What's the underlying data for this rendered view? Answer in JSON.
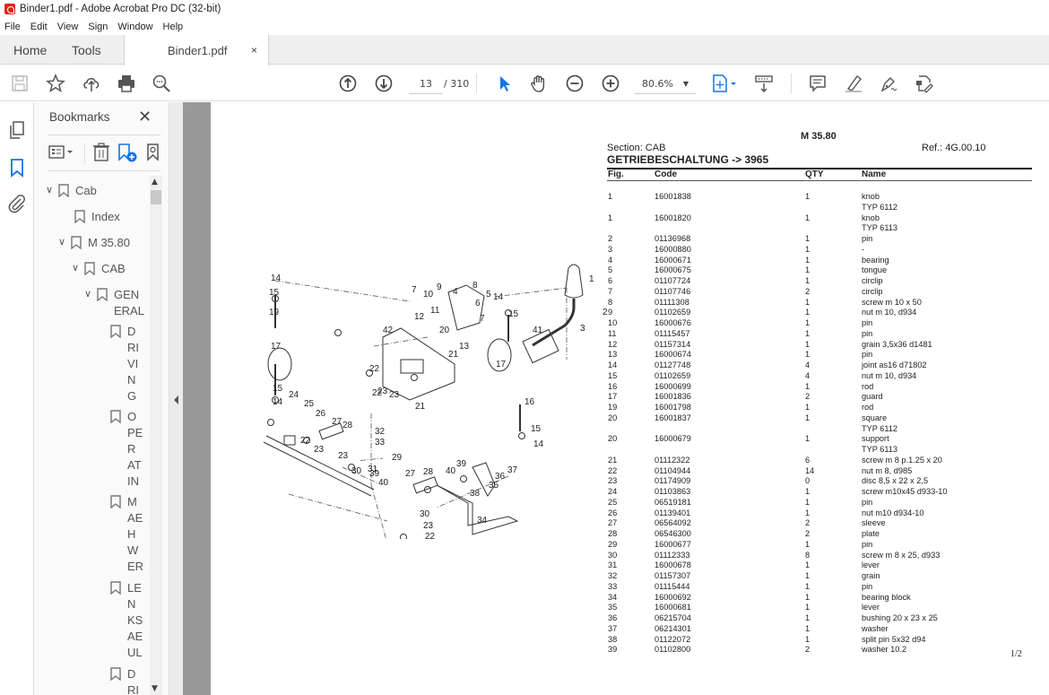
{
  "window": {
    "title": "Binder1.pdf - Adobe Acrobat Pro DC (32-bit)"
  },
  "menu": [
    "File",
    "Edit",
    "View",
    "Sign",
    "Window",
    "Help"
  ],
  "tabs": {
    "home": "Home",
    "tools": "Tools",
    "document": "Binder1.pdf",
    "close": "×"
  },
  "toolbar": {
    "current_page": "13",
    "total_pages": "/ 310",
    "zoom": "80.6%",
    "icons": [
      "save-icon",
      "bookmark-star-icon",
      "upload-cloud-icon",
      "print-icon",
      "search-zoom-icon",
      "page-up-icon",
      "page-down-icon",
      "select-cursor-icon",
      "hand-pan-icon",
      "zoom-out-icon",
      "zoom-in-icon",
      "fit-page-icon",
      "scroll-mode-icon",
      "comment-icon",
      "highlight-icon",
      "sign-icon",
      "fill-sign-icon"
    ],
    "accent": "#1473e6"
  },
  "panel": {
    "title": "Bookmarks",
    "close": "✕",
    "tree": [
      {
        "label": "Cab",
        "level": 0,
        "expanded": true
      },
      {
        "label": "Index",
        "level": 1
      },
      {
        "label": "M 35.80",
        "level": 1,
        "expanded": true
      },
      {
        "label": "CAB",
        "level": 2,
        "expanded": true
      },
      {
        "label": "GEN\nERAL",
        "level": 3,
        "expanded": true
      },
      {
        "label": "D\nRI\nVI\nN\nG",
        "level": 4
      },
      {
        "label": "O\nPE\nR\nAT\nIN",
        "level": 4
      },
      {
        "label": "M\nAE\nH\nW\nER",
        "level": 4
      },
      {
        "label": "LE\nN\nKS\nAE\nUL",
        "level": 4
      },
      {
        "label": "D\nRI",
        "level": 4
      }
    ]
  },
  "document": {
    "model": "M 35.80",
    "section": "Section: CAB",
    "ref": "Ref.: 4G.00.10",
    "heading": "GETRIEBESCHALTUNG -> 3965",
    "columns": {
      "fig": "Fig.",
      "code": "Code",
      "qty": "QTY",
      "name": "Name"
    },
    "page_indicator": "1/2",
    "rows": [
      {
        "fig": "1",
        "code": "16001838",
        "qty": "1",
        "name": "knob"
      },
      {
        "fig": "",
        "code": "",
        "qty": "",
        "name": "TYP 6112"
      },
      {
        "fig": "1",
        "code": "16001820",
        "qty": "1",
        "name": "knob"
      },
      {
        "fig": "",
        "code": "",
        "qty": "",
        "name": "TYP 6113"
      },
      {
        "fig": "2",
        "code": "01136968",
        "qty": "1",
        "name": "pin"
      },
      {
        "fig": "3",
        "code": "16000880",
        "qty": "1",
        "name": "-"
      },
      {
        "fig": "4",
        "code": "16000671",
        "qty": "1",
        "name": "bearing"
      },
      {
        "fig": "5",
        "code": "16000675",
        "qty": "1",
        "name": "tongue"
      },
      {
        "fig": "6",
        "code": "01107724",
        "qty": "1",
        "name": "circlip"
      },
      {
        "fig": "7",
        "code": "01107746",
        "qty": "2",
        "name": "circlip"
      },
      {
        "fig": "8",
        "code": "01111308",
        "qty": "1",
        "name": "screw m 10 x 50"
      },
      {
        "fig": "9",
        "code": "01102659",
        "qty": "1",
        "name": "nut m 10, d934"
      },
      {
        "fig": "10",
        "code": "16000676",
        "qty": "1",
        "name": "pin"
      },
      {
        "fig": "11",
        "code": "01115457",
        "qty": "1",
        "name": "pin"
      },
      {
        "fig": "12",
        "code": "01157314",
        "qty": "1",
        "name": "grain 3,5x36 d1481"
      },
      {
        "fig": "13",
        "code": "16000674",
        "qty": "1",
        "name": "pin"
      },
      {
        "fig": "14",
        "code": "01127748",
        "qty": "4",
        "name": "joint as16 d71802"
      },
      {
        "fig": "15",
        "code": "01102659",
        "qty": "4",
        "name": "nut m 10, d934"
      },
      {
        "fig": "16",
        "code": "16000699",
        "qty": "1",
        "name": "rod"
      },
      {
        "fig": "17",
        "code": "16001836",
        "qty": "2",
        "name": "guard"
      },
      {
        "fig": "19",
        "code": "16001798",
        "qty": "1",
        "name": "rod"
      },
      {
        "fig": "20",
        "code": "16001837",
        "qty": "1",
        "name": "square"
      },
      {
        "fig": "",
        "code": "",
        "qty": "",
        "name": "TYP 6112"
      },
      {
        "fig": "20",
        "code": "16000679",
        "qty": "1",
        "name": "support"
      },
      {
        "fig": "",
        "code": "",
        "qty": "",
        "name": "TYP 6113"
      },
      {
        "fig": "21",
        "code": "01112322",
        "qty": "6",
        "name": "screw m 8 p.1.25 x 20"
      },
      {
        "fig": "22",
        "code": "01104944",
        "qty": "14",
        "name": "nut m 8, d985"
      },
      {
        "fig": "23",
        "code": "01174909",
        "qty": "0",
        "name": "disc 8,5 x 22 x 2,5"
      },
      {
        "fig": "24",
        "code": "01103863",
        "qty": "1",
        "name": "screw m10x45 d933-10"
      },
      {
        "fig": "25",
        "code": "06519181",
        "qty": "1",
        "name": "pin"
      },
      {
        "fig": "26",
        "code": "01139401",
        "qty": "1",
        "name": "nut m10 d934-10"
      },
      {
        "fig": "27",
        "code": "06564092",
        "qty": "2",
        "name": "sleeve"
      },
      {
        "fig": "28",
        "code": "06546300",
        "qty": "2",
        "name": "plate"
      },
      {
        "fig": "29",
        "code": "16000677",
        "qty": "1",
        "name": "pin"
      },
      {
        "fig": "30",
        "code": "01112333",
        "qty": "8",
        "name": "screw m 8 x 25, d933"
      },
      {
        "fig": "31",
        "code": "16000678",
        "qty": "1",
        "name": "lever"
      },
      {
        "fig": "32",
        "code": "01157307",
        "qty": "1",
        "name": "grain"
      },
      {
        "fig": "33",
        "code": "01115444",
        "qty": "1",
        "name": "pin"
      },
      {
        "fig": "34",
        "code": "16000692",
        "qty": "1",
        "name": "bearing block"
      },
      {
        "fig": "35",
        "code": "16000681",
        "qty": "1",
        "name": "lever"
      },
      {
        "fig": "36",
        "code": "06215704",
        "qty": "1",
        "name": "bushing 20 x 23 x 25"
      },
      {
        "fig": "37",
        "code": "06214301",
        "qty": "1",
        "name": "washer"
      },
      {
        "fig": "38",
        "code": "01122072",
        "qty": "1",
        "name": "split pin 5x32 d94"
      },
      {
        "fig": "39",
        "code": "01102800",
        "qty": "2",
        "name": "washer 10.2"
      }
    ],
    "diagram_labels": [
      "14",
      "15",
      "19",
      "17",
      "15",
      "14",
      "7",
      "10",
      "9",
      "4",
      "8",
      "5",
      "6",
      "7",
      "14",
      "15",
      "12",
      "11",
      "13",
      "42",
      "20",
      "21",
      "22",
      "22",
      "23",
      "23",
      "21",
      "17",
      "41",
      "1",
      "2",
      "3",
      "16",
      "15",
      "14",
      "24",
      "25",
      "26",
      "27",
      "28",
      "22",
      "23",
      "23",
      "30",
      "31",
      "32",
      "33",
      "29",
      "39",
      "40",
      "27",
      "28",
      "40",
      "39",
      "36",
      "37",
      "35",
      "38",
      "30",
      "23",
      "22",
      "34"
    ]
  }
}
